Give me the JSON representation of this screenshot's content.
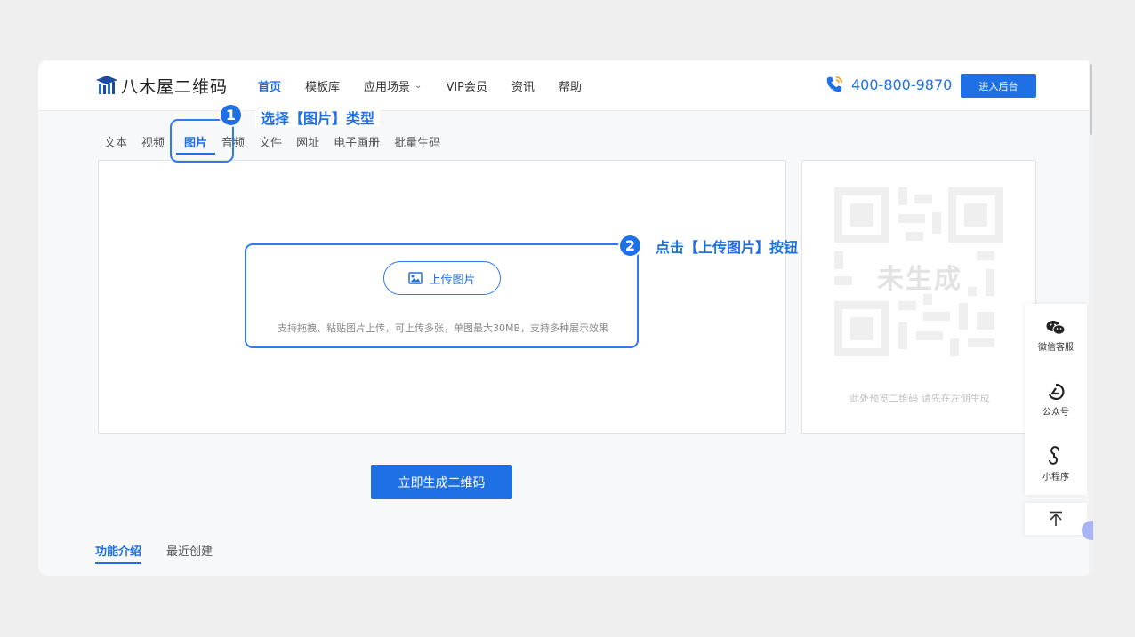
{
  "header": {
    "logo_text": "八木屋二维码",
    "nav": [
      {
        "label": "首页",
        "active": true
      },
      {
        "label": "模板库"
      },
      {
        "label": "应用场景",
        "dropdown": true
      },
      {
        "label": "VIP会员"
      },
      {
        "label": "资讯"
      },
      {
        "label": "帮助"
      }
    ],
    "phone": "400-800-9870",
    "admin_button": "进入后台"
  },
  "tabs": [
    "文本",
    "视频",
    "图片",
    "音频",
    "文件",
    "网址",
    "电子画册",
    "批量生码"
  ],
  "active_tab": "图片",
  "callouts": {
    "step1_number": "1",
    "step1_text": "选择【图片】类型",
    "step2_number": "2",
    "step2_text": "点击【上传图片】按钮"
  },
  "upload": {
    "button_label": "上传图片",
    "hint": "支持拖拽、粘贴图片上传，可上传多张，单图最大30MB，支持多种展示效果"
  },
  "preview": {
    "placeholder_label": "未生成",
    "hint": "此处预览二维码 请先在左侧生成"
  },
  "generate_button": "立即生成二维码",
  "subtabs": [
    {
      "label": "功能介绍",
      "active": true
    },
    {
      "label": "最近创建"
    }
  ],
  "float_bar": {
    "wechat_service": "微信客服",
    "official_account": "公众号",
    "mini_program": "小程序"
  },
  "colors": {
    "accent": "#1f6fe5",
    "background": "#efefef"
  }
}
